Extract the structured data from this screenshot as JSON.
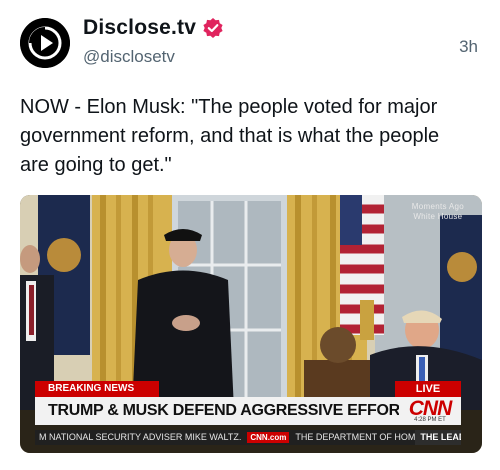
{
  "author": {
    "name": "Disclose.tv",
    "handle": "@disclosetv",
    "avatar_icon": "play-icon",
    "verified_icon": "verified-badge-icon",
    "verified_color": "#e0245e"
  },
  "post": {
    "timestamp": "3h",
    "text": "NOW - Elon Musk: \"The people voted for major government reform, and that is what the people are going to get.\""
  },
  "media": {
    "corner_bug": [
      "Moments Ago",
      "White House"
    ],
    "breaking_label": "BREAKING NEWS",
    "live_label": "LIVE",
    "headline": "TRUMP & MUSK DEFEND AGGRESSIVE EFFORTS TO OVERHAUL GOVT",
    "network_logo": "CNN",
    "clock": "4:28 PM ET",
    "ticker_left": "M NATIONAL SECURITY ADVISER MIKE WALTZ.",
    "ticker_chip": "CNN.com",
    "ticker_right": "THE DEPARTMENT OF HOM",
    "ticker_program": "THE LEAD",
    "accent_red": "#cc0000"
  }
}
